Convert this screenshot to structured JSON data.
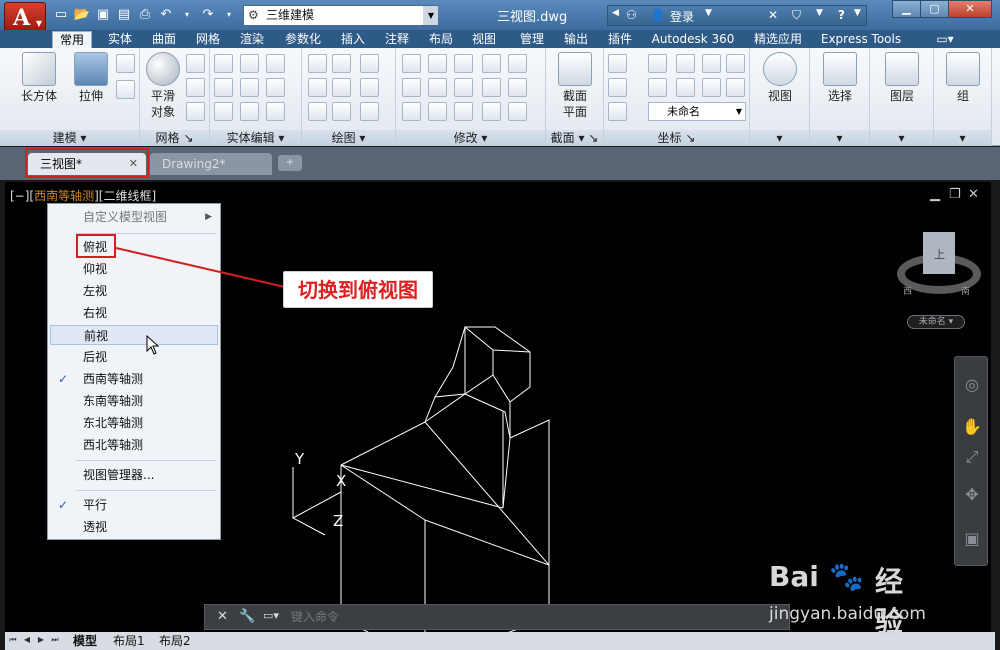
{
  "titlebar": {
    "app_letter": "A",
    "workspace": "三维建模",
    "doc_title": "三视图.dwg",
    "login": "登录",
    "help": "?"
  },
  "ribbon_tabs": [
    "常用",
    "实体",
    "曲面",
    "网格",
    "渲染",
    "参数化",
    "插入",
    "注释",
    "布局",
    "视图",
    "管理",
    "输出",
    "插件",
    "Autodesk 360",
    "精选应用",
    "Express Tools"
  ],
  "ribbon": {
    "model_panel": {
      "label": "建模",
      "box": "长方体",
      "extrude": "拉伸"
    },
    "mesh_panel": {
      "label": "网格",
      "smooth_line1": "平滑",
      "smooth_line2": "对象"
    },
    "solid_edit_panel": {
      "label": "实体编辑"
    },
    "draw_panel": {
      "label": "绘图"
    },
    "modify_panel": {
      "label": "修改"
    },
    "section_panel": {
      "label": "截面",
      "btn_line1": "截面",
      "btn_line2": "平面"
    },
    "coord_panel": {
      "label": "坐标",
      "ucs_name": "未命名"
    },
    "view_btn": "视图",
    "select_btn": "选择",
    "layer_btn": "图层",
    "group_btn": "组"
  },
  "file_tabs": [
    {
      "label": "三视图*",
      "active": true
    },
    {
      "label": "Drawing2*",
      "active": false
    }
  ],
  "viewport": {
    "label_prefix": "[−][",
    "view_name": "西南等轴测",
    "label_suffix": "][二维线框]"
  },
  "context_menu": {
    "custom": "自定义模型视图",
    "top": "俯视",
    "bottom": "仰视",
    "left": "左视",
    "right": "右视",
    "front": "前视",
    "back": "后视",
    "sw_iso": "西南等轴测",
    "se_iso": "东南等轴测",
    "ne_iso": "东北等轴测",
    "nw_iso": "西北等轴测",
    "view_manager": "视图管理器...",
    "parallel": "平行",
    "perspective": "透视",
    "check": "✓"
  },
  "callout": "切换到俯视图",
  "viewcube": {
    "face": "上",
    "west": "西",
    "south": "南",
    "unnamed": "未命名"
  },
  "ucs": {
    "x": "X",
    "y": "Y",
    "z": "Z"
  },
  "command": {
    "placeholder": "键入命令"
  },
  "layout_tabs": [
    "模型",
    "布局1",
    "布局2"
  ],
  "watermark": {
    "brand": "Bai",
    "brand2": "经验",
    "url": "jingyan.baidu.com"
  }
}
